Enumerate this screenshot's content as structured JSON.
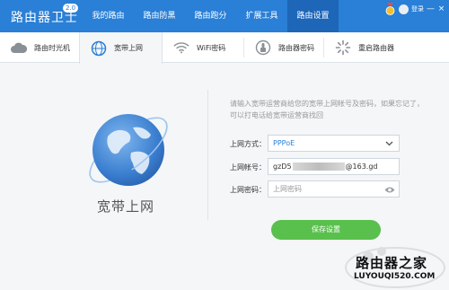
{
  "app": {
    "title": "路由器卫士",
    "version": "2.0"
  },
  "nav": [
    {
      "label": "我的路由"
    },
    {
      "label": "路由防黑"
    },
    {
      "label": "路由跑分"
    },
    {
      "label": "扩展工具"
    },
    {
      "label": "路由设置",
      "active": true
    }
  ],
  "top_right": {
    "login_label": "登录",
    "minimize": "—",
    "close": "×"
  },
  "subtabs": [
    {
      "label": "路由时光机",
      "icon": "cloud-icon"
    },
    {
      "label": "宽带上网",
      "icon": "globe-icon",
      "active": true
    },
    {
      "label": "WiFi密码",
      "icon": "wifi-icon"
    },
    {
      "label": "路由器密码",
      "icon": "lock-badge-icon"
    },
    {
      "label": "重启路由器",
      "icon": "restart-spinner-icon"
    }
  ],
  "main": {
    "globe_label": "宽带上网",
    "hint": "请输入宽带运营商给您的宽带上网帐号及密码，如果忘记了，可以打电话给宽带运营商找回",
    "form": {
      "mode_label": "上网方式：",
      "mode_value": "PPPoE",
      "account_label": "上网帐号：",
      "account_prefix": "gzD5",
      "account_suffix": "@163.gd",
      "password_label": "上网密码：",
      "password_placeholder": "上网密码"
    },
    "save_label": "保存设置"
  },
  "watermark": {
    "title": "路由器之家",
    "url": "LUYOUQI520.COM"
  },
  "colors": {
    "topbar": "#2a7fd6",
    "nav_active": "#1d66b8",
    "save_button": "#59c04d",
    "globe": "#3b7fd0"
  }
}
